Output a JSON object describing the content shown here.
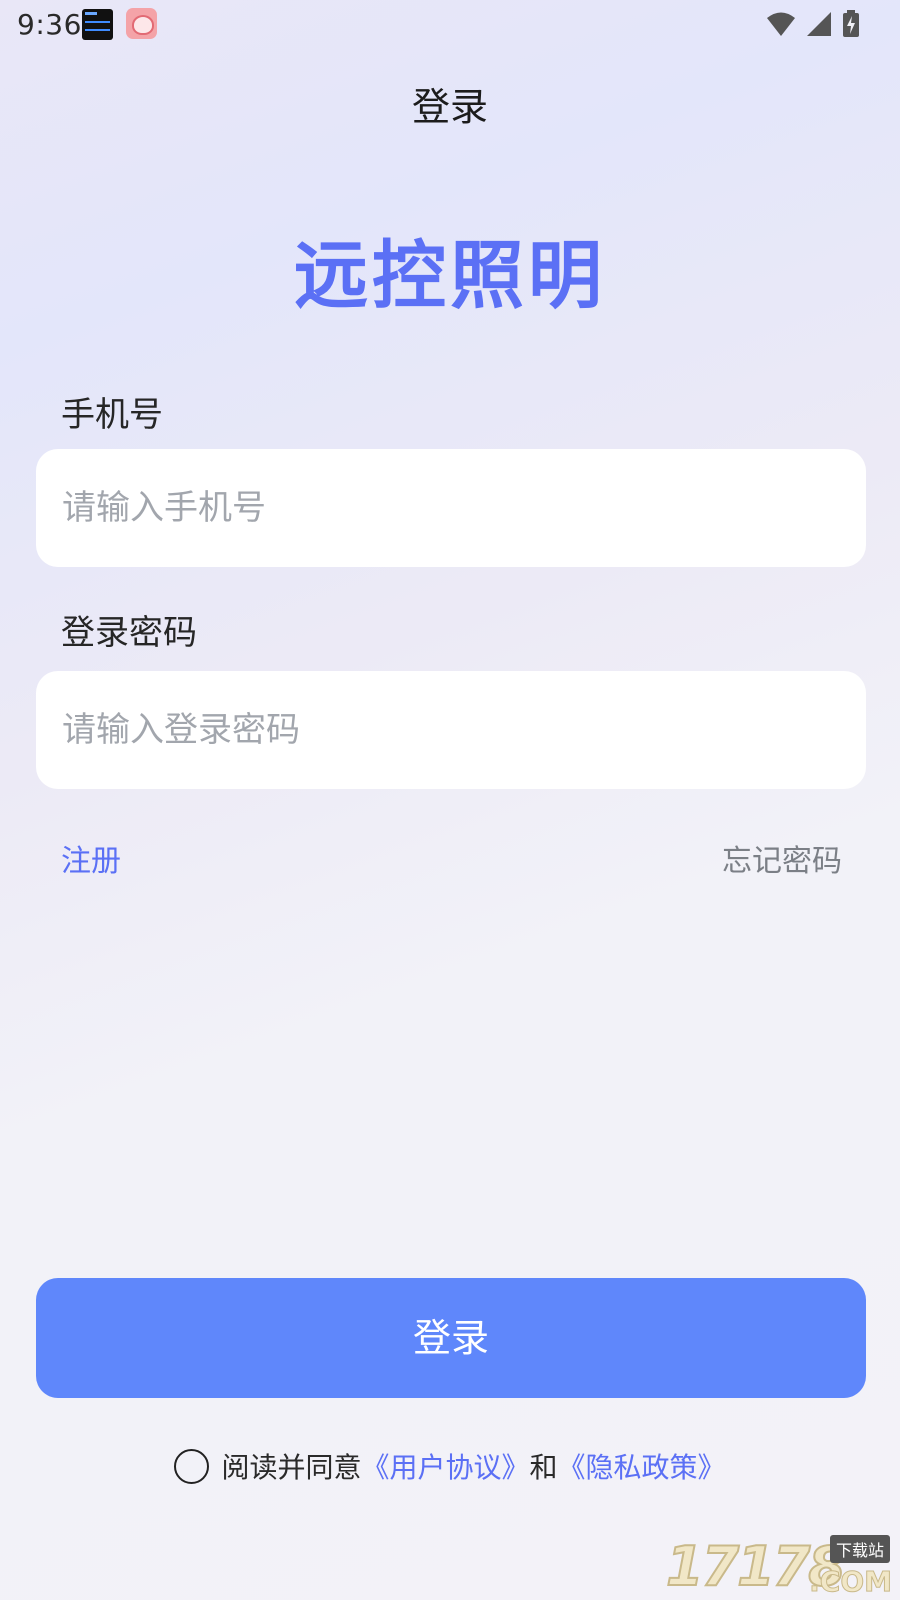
{
  "status_bar": {
    "time": "9:36",
    "icons": [
      "clock-widget-icon",
      "app-notification-icon",
      "wifi-icon",
      "signal-icon",
      "battery-charging-icon"
    ]
  },
  "header": {
    "title": "登录"
  },
  "app_name": "远控照明",
  "form": {
    "phone": {
      "label": "手机号",
      "placeholder": "请输入手机号",
      "value": ""
    },
    "password": {
      "label": "登录密码",
      "placeholder": "请输入登录密码",
      "value": ""
    }
  },
  "links": {
    "register": "注册",
    "forgot_password": "忘记密码"
  },
  "login_button": "登录",
  "agreement": {
    "checked": false,
    "prefix": "阅读并同意",
    "user_agreement": "《用户协议》",
    "and": "和",
    "privacy_policy": "《隐私政策》"
  },
  "watermark": {
    "digits": "17178",
    "tag": "下载站",
    "suffix": ".COM"
  },
  "colors": {
    "accent": "#5b70f5",
    "button": "#5f87fb",
    "secondary_link": "#7b7f86",
    "placeholder": "#a2a6ad"
  }
}
